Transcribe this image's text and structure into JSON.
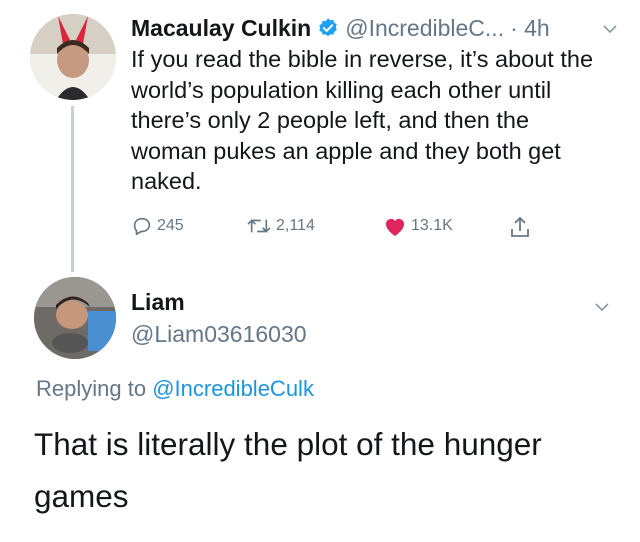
{
  "tweet": {
    "author_name": "Macaulay Culkin",
    "author_handle": "@IncredibleC...",
    "time": "· 4h",
    "text": "If you read the bible in reverse, it’s about the world’s population killing each other until there’s only 2 people left, and then the woman pukes an apple and they both get naked.",
    "replies": "245",
    "retweets": "2,114",
    "likes": "13.1K",
    "verified": true,
    "like_color": "#e0245e",
    "verified_color": "#1da1f2"
  },
  "reply": {
    "author_name": "Liam",
    "author_handle": "@Liam03616030",
    "replying_prefix": "Replying to",
    "replying_to": "@IncredibleCulk",
    "text": "That is literally the plot of the hunger games",
    "link_color": "#1b95e0"
  },
  "icons": [
    "reply-icon",
    "retweet-icon",
    "like-icon",
    "share-icon",
    "verified-icon",
    "chevron-down-icon"
  ]
}
